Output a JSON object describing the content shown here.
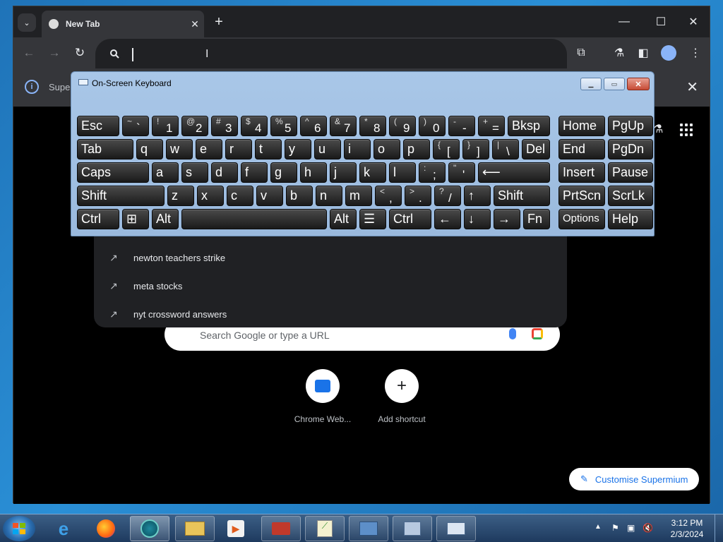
{
  "browser": {
    "tab_title": "New Tab",
    "omnibox_value": "",
    "infobar_text": "Supe",
    "suggestions": [
      {
        "text": "newton teachers strike"
      },
      {
        "text": "meta stocks"
      },
      {
        "text": "nyt crossword answers"
      }
    ],
    "ntp_search_placeholder": "Search Google or type a URL",
    "shortcuts": [
      {
        "label": "Chrome Web..."
      },
      {
        "label": "Add shortcut"
      }
    ],
    "customise_label": "Customise Supermium"
  },
  "osk": {
    "title": "On-Screen Keyboard",
    "rows": [
      [
        {
          "label": "Esc"
        },
        {
          "shift": "~",
          "main": "`"
        },
        {
          "shift": "!",
          "main": "1"
        },
        {
          "shift": "@",
          "main": "2"
        },
        {
          "shift": "#",
          "main": "3"
        },
        {
          "shift": "$",
          "main": "4"
        },
        {
          "shift": "%",
          "main": "5"
        },
        {
          "shift": "^",
          "main": "6"
        },
        {
          "shift": "&",
          "main": "7"
        },
        {
          "shift": "*",
          "main": "8"
        },
        {
          "shift": "(",
          "main": "9"
        },
        {
          "shift": ")",
          "main": "0"
        },
        {
          "shift": "-",
          "main": "-"
        },
        {
          "shift": "+",
          "main": "="
        },
        {
          "label": "Bksp"
        },
        {
          "label": "Home"
        },
        {
          "label": "PgUp"
        }
      ],
      [
        {
          "label": "Tab"
        },
        {
          "label": "q"
        },
        {
          "label": "w"
        },
        {
          "label": "e"
        },
        {
          "label": "r"
        },
        {
          "label": "t"
        },
        {
          "label": "y"
        },
        {
          "label": "u"
        },
        {
          "label": "i"
        },
        {
          "label": "o"
        },
        {
          "label": "p"
        },
        {
          "shift": "{",
          "main": "["
        },
        {
          "shift": "}",
          "main": "]"
        },
        {
          "shift": "|",
          "main": "\\"
        },
        {
          "label": "Del"
        },
        {
          "label": "End"
        },
        {
          "label": "PgDn"
        }
      ],
      [
        {
          "label": "Caps"
        },
        {
          "label": "a"
        },
        {
          "label": "s"
        },
        {
          "label": "d"
        },
        {
          "label": "f"
        },
        {
          "label": "g"
        },
        {
          "label": "h"
        },
        {
          "label": "j"
        },
        {
          "label": "k"
        },
        {
          "label": "l"
        },
        {
          "shift": ":",
          "main": ";"
        },
        {
          "shift": "\"",
          "main": "'"
        },
        {
          "label": "⟵"
        },
        {
          "label": "Insert"
        },
        {
          "label": "Pause"
        }
      ],
      [
        {
          "label": "Shift"
        },
        {
          "label": "z"
        },
        {
          "label": "x"
        },
        {
          "label": "c"
        },
        {
          "label": "v"
        },
        {
          "label": "b"
        },
        {
          "label": "n"
        },
        {
          "label": "m"
        },
        {
          "shift": "<",
          "main": ","
        },
        {
          "shift": ">",
          "main": "."
        },
        {
          "shift": "?",
          "main": "/"
        },
        {
          "label": "↑"
        },
        {
          "label": "Shift"
        },
        {
          "label": "PrtScn"
        },
        {
          "label": "ScrLk"
        }
      ],
      [
        {
          "label": "Ctrl"
        },
        {
          "label": "⊞"
        },
        {
          "label": "Alt"
        },
        {
          "label": ""
        },
        {
          "label": "Alt"
        },
        {
          "label": "☰"
        },
        {
          "label": "Ctrl"
        },
        {
          "label": "←"
        },
        {
          "label": "↓"
        },
        {
          "label": "→"
        },
        {
          "label": "Fn"
        },
        {
          "label": "Options"
        },
        {
          "label": "Help"
        }
      ]
    ]
  },
  "taskbar": {
    "time": "3:12 PM",
    "date": "2/3/2024",
    "items": [
      {
        "icon": "internet-explorer-icon"
      },
      {
        "icon": "firefox-icon"
      },
      {
        "icon": "supermium-icon"
      },
      {
        "icon": "file-explorer-icon"
      },
      {
        "icon": "media-player-icon"
      },
      {
        "icon": "toolbox-icon"
      },
      {
        "icon": "chart-editor-icon"
      },
      {
        "icon": "control-panel-icon"
      },
      {
        "icon": "remote-computer-icon"
      },
      {
        "icon": "on-screen-keyboard-icon"
      }
    ]
  }
}
